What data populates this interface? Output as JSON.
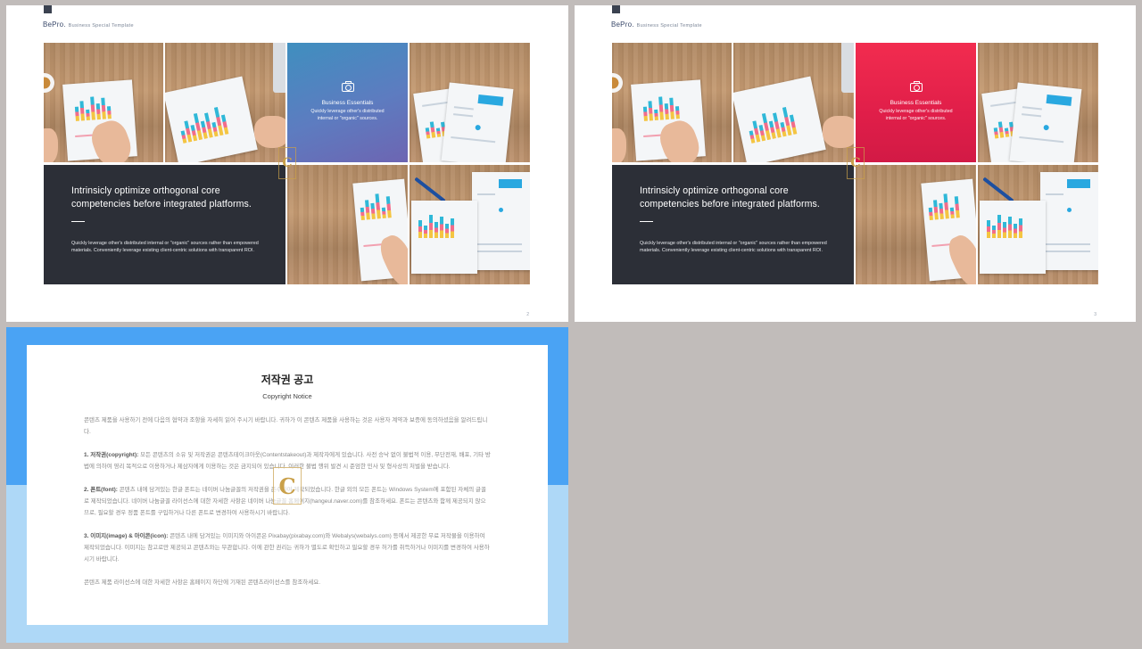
{
  "slides": [
    {
      "brand_name": "BePro.",
      "brand_tag": "Business  Special  Template",
      "page_number": "2",
      "feature_title": "Business Essentials",
      "feature_text": "Quickly leverage other's distributed internal or \"organic\" sources.",
      "headline": "Intrinsicly optimize orthogonal core competencies before integrated platforms.",
      "body": "Quickly leverage other's distributed internal or \"organic\" sources rather than empowered materials. Conveniently leverage existing client-centric solutions with transparent ROI.",
      "accent_color": "#4f84c2",
      "panel_color": "#2c2f37"
    },
    {
      "brand_name": "BePro.",
      "brand_tag": "Business  Special  Template",
      "page_number": "3",
      "feature_title": "Business Essentials",
      "feature_text": "Quickly leverage other's distributed internal or \"organic\" sources.",
      "headline": "Intrinsicly optimize orthogonal core competencies before integrated platforms.",
      "body": "Quickly leverage other's distributed internal or \"organic\" sources rather than empowered materials. Conveniently leverage existing client-centric solutions with transparent ROI.",
      "accent_color": "#e8234a",
      "panel_color": "#2c2f37"
    }
  ],
  "notice": {
    "title": "저작권 공고",
    "subtitle": "Copyright Notice",
    "intro": "콘텐츠 제품을 사용하기 전에 다음의 협약과 조항을 자세히 읽어 주시기 바랍니다. 귀하가 이 콘텐츠 제품을 사용하는 것은 사용자 계약과 보증에 동의하셨음을 알려드립니다.",
    "sections": [
      {
        "heading": "1. 저작권(copyright):",
        "text": " 모든 콘텐츠의 소유 및 저작권은 콘텐츠테이크아웃(Contentstakeout)과 제작자에게 있습니다. 사전 승낙 없이 불법적 이용, 무단전재, 배포, 기타 방법에 의하여 영리 목적으로 이용하거나 제삼자에게 이용하는 것은 금지되어 있습니다. 이러한 불법 행위 발견 시 준엄한 민사 및 형사상의 처벌을 받습니다."
      },
      {
        "heading": "2. 폰트(font):",
        "text": " 콘텐츠 내에 담겨있는 한글 폰트는 네이버 나눔글꼴의 저작권을 준수하여 제작되었습니다. 한글 외의 모든 폰트는 Windows System에 포함된 자체의 글꼴로 제작되었습니다. 네이버 나눔글꼴 라이선스에 대한 자세한 사항은 네이버 나눔글꼴 홈페이지(hangeul.naver.com)를 참조하세요. 폰트는 콘텐츠와 함께 제공되지 않으므로, 필요할 경우 정품 폰트를 구입하거나 다른 폰트로 변경하여 사용하시기 바랍니다."
      },
      {
        "heading": "3. 이미지(image) & 아이콘(icon):",
        "text": " 콘텐츠 내에 담겨있는 이미지와 아이콘은 Pixabay(pixabay.com)와 Webalys(webalys.com) 등에서 제공한 무료 저작물을 이용하여 제작되었습니다. 이미지는 참고로만 제공되고 콘텐츠와는 무관합니다. 이에 관한 권리는 귀하가 별도로 확인하고 필요할 경우 허가를 취득하거나 이미지를 변경하여 사용하시기 바랍니다."
      }
    ],
    "outro": "콘텐츠 제품 라이선스에 대한 자세한 사항은 홈페이지 하단에 기재된 콘텐츠라이선스를 참조하세요.",
    "logo_letter": "C",
    "frame_colors": {
      "top": "#4aa3f4",
      "bottom": "#aed8f7"
    }
  }
}
